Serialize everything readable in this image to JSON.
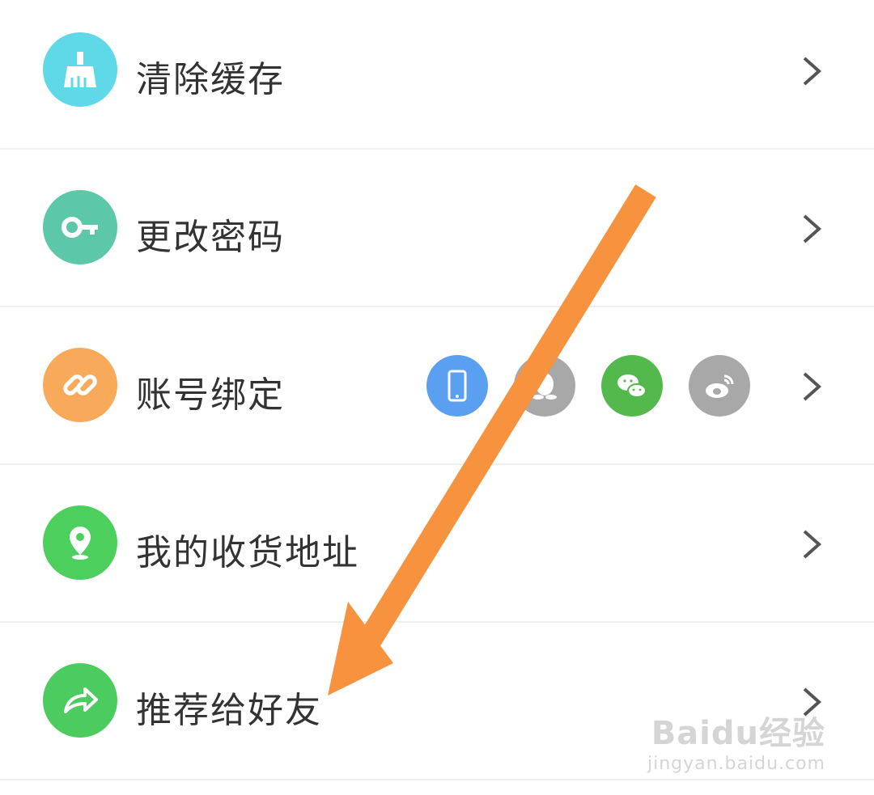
{
  "settings": {
    "items": [
      {
        "label": "清除缓存",
        "icon": "broom-icon",
        "color": "#5FD8E8"
      },
      {
        "label": "更改密码",
        "icon": "key-icon",
        "color": "#5CC8A8"
      },
      {
        "label": "账号绑定",
        "icon": "link-icon",
        "color": "#F8A95A"
      },
      {
        "label": "我的收货地址",
        "icon": "location-pin-icon",
        "color": "#4CCF5C"
      },
      {
        "label": "推荐给好友",
        "icon": "share-icon",
        "color": "#4CCB5E"
      }
    ],
    "bindings": [
      {
        "name": "phone",
        "icon": "phone-icon",
        "color": "#5B9FF0"
      },
      {
        "name": "qq",
        "icon": "qq-icon",
        "color": "#A8A8A8"
      },
      {
        "name": "wechat",
        "icon": "wechat-icon",
        "color": "#53B94C"
      },
      {
        "name": "weibo",
        "icon": "weibo-icon",
        "color": "#A8A8A8"
      }
    ]
  },
  "annotation": {
    "color": "#F7923F"
  },
  "watermark": {
    "main": "Baidu经验",
    "sub": "jingyan.baidu.com"
  }
}
